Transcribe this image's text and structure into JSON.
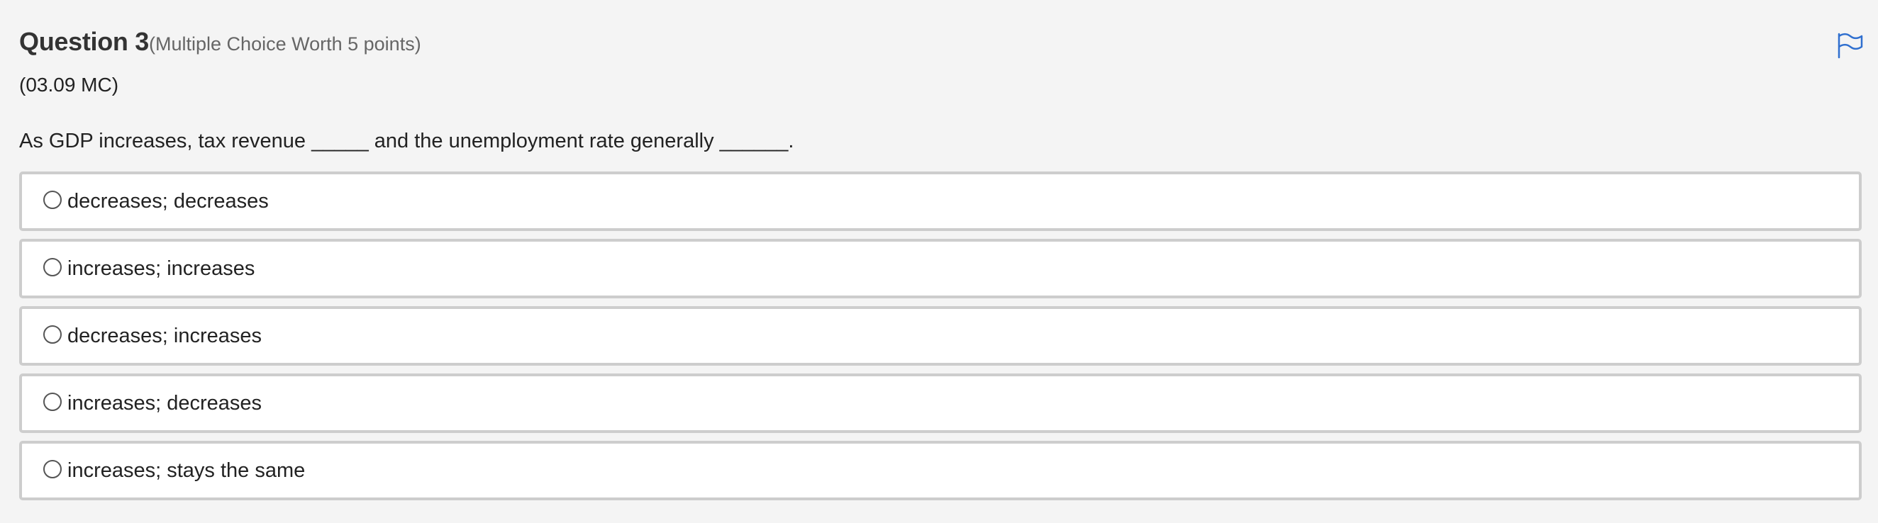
{
  "question": {
    "title": "Question 3",
    "type_label": "(Multiple Choice Worth 5 points)",
    "code": "(03.09 MC)",
    "prompt": "As GDP increases, tax revenue _____ and the unemployment rate generally ______.",
    "flag_icon": "flag-icon"
  },
  "options": [
    {
      "label": "decreases; decreases"
    },
    {
      "label": "increases; increases"
    },
    {
      "label": "decreases; increases"
    },
    {
      "label": "increases; decreases"
    },
    {
      "label": "increases; stays the same"
    }
  ],
  "colors": {
    "background": "#f4f4f4",
    "option_border": "#cdcdcd",
    "flag": "#2f6fcf",
    "text": "#222222",
    "muted_text": "#666666"
  }
}
